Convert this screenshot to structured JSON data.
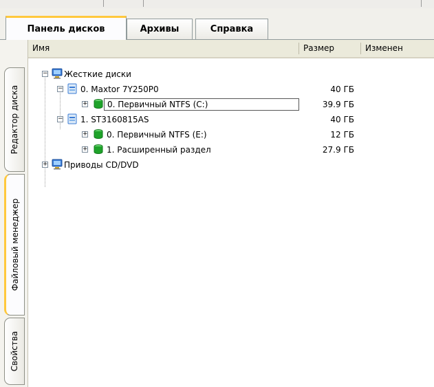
{
  "tabs": [
    {
      "label": "Панель дисков",
      "active": true
    },
    {
      "label": "Архивы",
      "active": false
    },
    {
      "label": "Справка",
      "active": false
    }
  ],
  "side_tabs": [
    {
      "label": "Редактор диска",
      "active": false
    },
    {
      "label": "Файловый менеджер",
      "active": true
    },
    {
      "label": "Свойства",
      "active": false
    }
  ],
  "columns": {
    "name": "Имя",
    "size": "Размер",
    "modified": "Изменен"
  },
  "tree": [
    {
      "label": "Жесткие диски",
      "size": "",
      "icon": "computer-icon",
      "expander": "-"
    },
    {
      "label": "0. Maxtor 7Y250P0",
      "size": "40 ГБ",
      "icon": "hard-disk-icon",
      "expander": "-"
    },
    {
      "label": "0. Первичный NTFS (C:)",
      "size": "39.9 ГБ",
      "icon": "partition-icon",
      "expander": "+"
    },
    {
      "label": "1. ST3160815AS",
      "size": "40 ГБ",
      "icon": "hard-disk-icon",
      "expander": "-"
    },
    {
      "label": "0. Первичный NTFS (E:)",
      "size": "12 ГБ",
      "icon": "partition-icon",
      "expander": "+"
    },
    {
      "label": "1. Расширенный раздел",
      "size": "27.9 ГБ",
      "icon": "partition-icon",
      "expander": "+"
    },
    {
      "label": "Приводы CD/DVD",
      "size": "",
      "icon": "computer-icon",
      "expander": "+"
    }
  ],
  "colors": {
    "accent": "#ffc83c",
    "partition": "#1fa32a",
    "disk": "#3a7bd5",
    "header": "#ebeadb"
  }
}
